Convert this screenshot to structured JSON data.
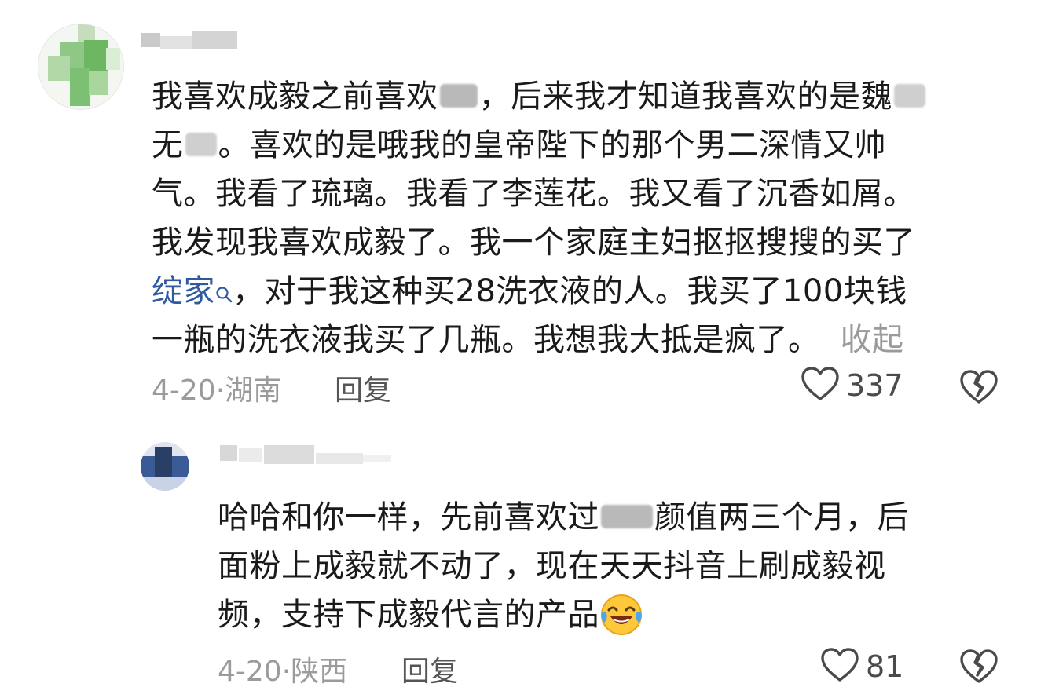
{
  "comments": [
    {
      "lines": [
        [
          "我喜欢成毅之前喜欢",
          "CENSOR",
          "，后来我才知道我喜欢的是魏",
          "CENSOR"
        ],
        [
          "无",
          "CENSOR",
          "。喜欢的是哦我的皇帝陛下的那个男二深情又帅"
        ],
        [
          "气。我看了琉璃。我看了李莲花。我又看了沉香如屑。"
        ],
        [
          "我发现我喜欢成毅了。我一个家庭主妇抠抠搜搜的买了"
        ],
        [
          "LINK",
          "，对于我这种买28洗衣液的人。我买了100块钱"
        ],
        [
          "一瓶的洗衣液我买了几瓶。我想我大抵是疯了。",
          "COLLAPSE"
        ]
      ],
      "line1_a": "我喜欢成毅之前喜欢",
      "line1_b": "，后来我才知道我喜欢的是魏",
      "line2_a": "无",
      "line2_b": "。喜欢的是哦我的皇帝陛下的那个男二深情又帅",
      "line3": "气。我看了琉璃。我看了李莲花。我又看了沉香如屑。",
      "line4": "我发现我喜欢成毅了。我一个家庭主妇抠抠搜搜的买了",
      "line5_link": "绽家",
      "line5_b": "，对于我这种买28洗衣液的人。我买了100块钱",
      "line6": "一瓶的洗衣液我买了几瓶。我想我大抵是疯了。",
      "collapse_label": "收起",
      "meta": "4-20·湖南",
      "reply_label": "回复",
      "likes": "337"
    },
    {
      "line1_a": "哈哈和你一样，先前喜欢过",
      "line1_b": "颜值两三个月，后",
      "line2": "面粉上成毅就不动了，现在天天抖音上刷成毅视",
      "line3": "频，支持下成毅代言的产品",
      "emoji": "laughing-crying-emoji",
      "meta": "4-20·陕西",
      "reply_label": "回复",
      "likes": "81"
    }
  ],
  "icons": {
    "like": "heart-outline-icon",
    "dislike": "broken-heart-icon",
    "search": "search-icon"
  },
  "colors": {
    "text": "#1a1a1a",
    "meta": "#9b9b9b",
    "link": "#2e5aa1"
  }
}
